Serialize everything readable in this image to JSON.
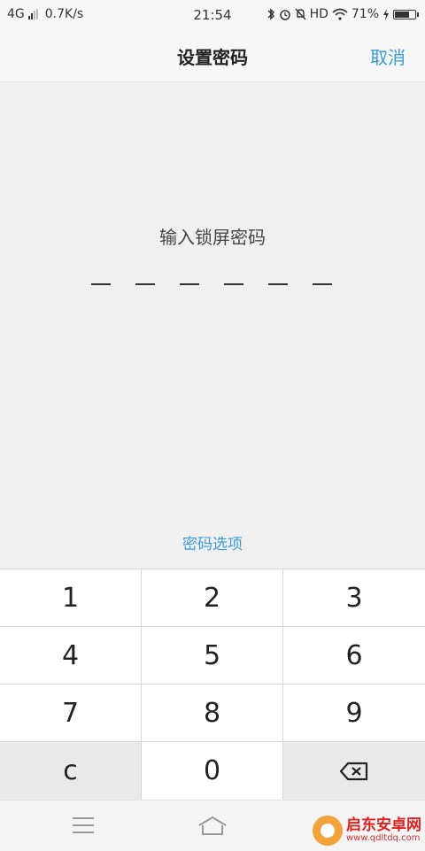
{
  "status": {
    "network": "4G",
    "speed": "0.7K/s",
    "time": "21:54",
    "hd": "HD",
    "battery": "71%",
    "battery_level": 0.71,
    "icons": [
      "bluetooth-icon",
      "alarm-icon",
      "mute-icon",
      "wifi-icon",
      "charging-icon"
    ]
  },
  "header": {
    "title": "设置密码",
    "cancel": "取消"
  },
  "main": {
    "prompt": "输入锁屏密码",
    "slot_count": 6,
    "options": "密码选项"
  },
  "keypad": {
    "keys": [
      "1",
      "2",
      "3",
      "4",
      "5",
      "6",
      "7",
      "8",
      "9",
      "c",
      "0",
      "backspace-icon"
    ]
  },
  "watermark": {
    "brand": "启东安卓网",
    "url": "www.qdltdq.com"
  },
  "colors": {
    "accent": "#3a9bd9",
    "background": "#f0f0f0",
    "key_gray": "#e9e9e9"
  }
}
